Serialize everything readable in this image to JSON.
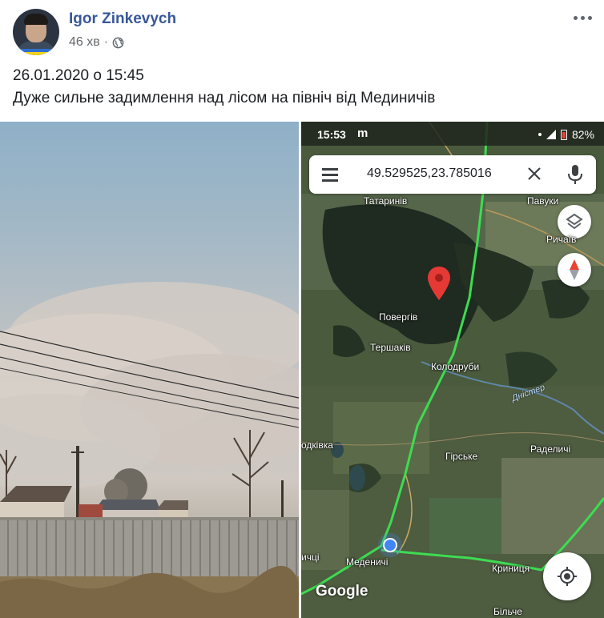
{
  "post": {
    "author": "Igor Zinkevych",
    "time_ago": "46 хв",
    "separator": "·",
    "privacy_icon": "globe-icon",
    "more_icon": "ellipsis-icon",
    "text_line_1": "26.01.2020 о 15:45",
    "text_line_2": "Дуже сильне задимлення над лісом на північ від Мединичів"
  },
  "map_screenshot": {
    "status": {
      "time": "15:53",
      "carrier_letter": "m",
      "battery": "82%"
    },
    "search": {
      "query": "49.529525,23.785016",
      "menu_icon": "hamburger-menu-icon",
      "clear_icon": "close-icon",
      "mic_icon": "microphone-icon"
    },
    "places": {
      "tatarynyv": "Татаринів",
      "pavuky": "Павуки",
      "rychaiv": "Ричаїв",
      "povergiv": "Повергів",
      "tershakiv": "Тершаків",
      "kolodruby": "Колодруби",
      "dnister": "Дністер",
      "odkivka": "одківка",
      "radelychi": "Раделичі",
      "girske": "Гірське",
      "mchytsi": "ичці",
      "medenychi": "Меденичі",
      "krynytsia": "Криниця",
      "bilche": "Більче"
    },
    "logo": "Google",
    "colors": {
      "route": "#3ddc52",
      "pin": "#e53935",
      "my_location": "#4285f4"
    }
  },
  "colors": {
    "author_link": "#385898",
    "meta_text": "#65676b"
  }
}
